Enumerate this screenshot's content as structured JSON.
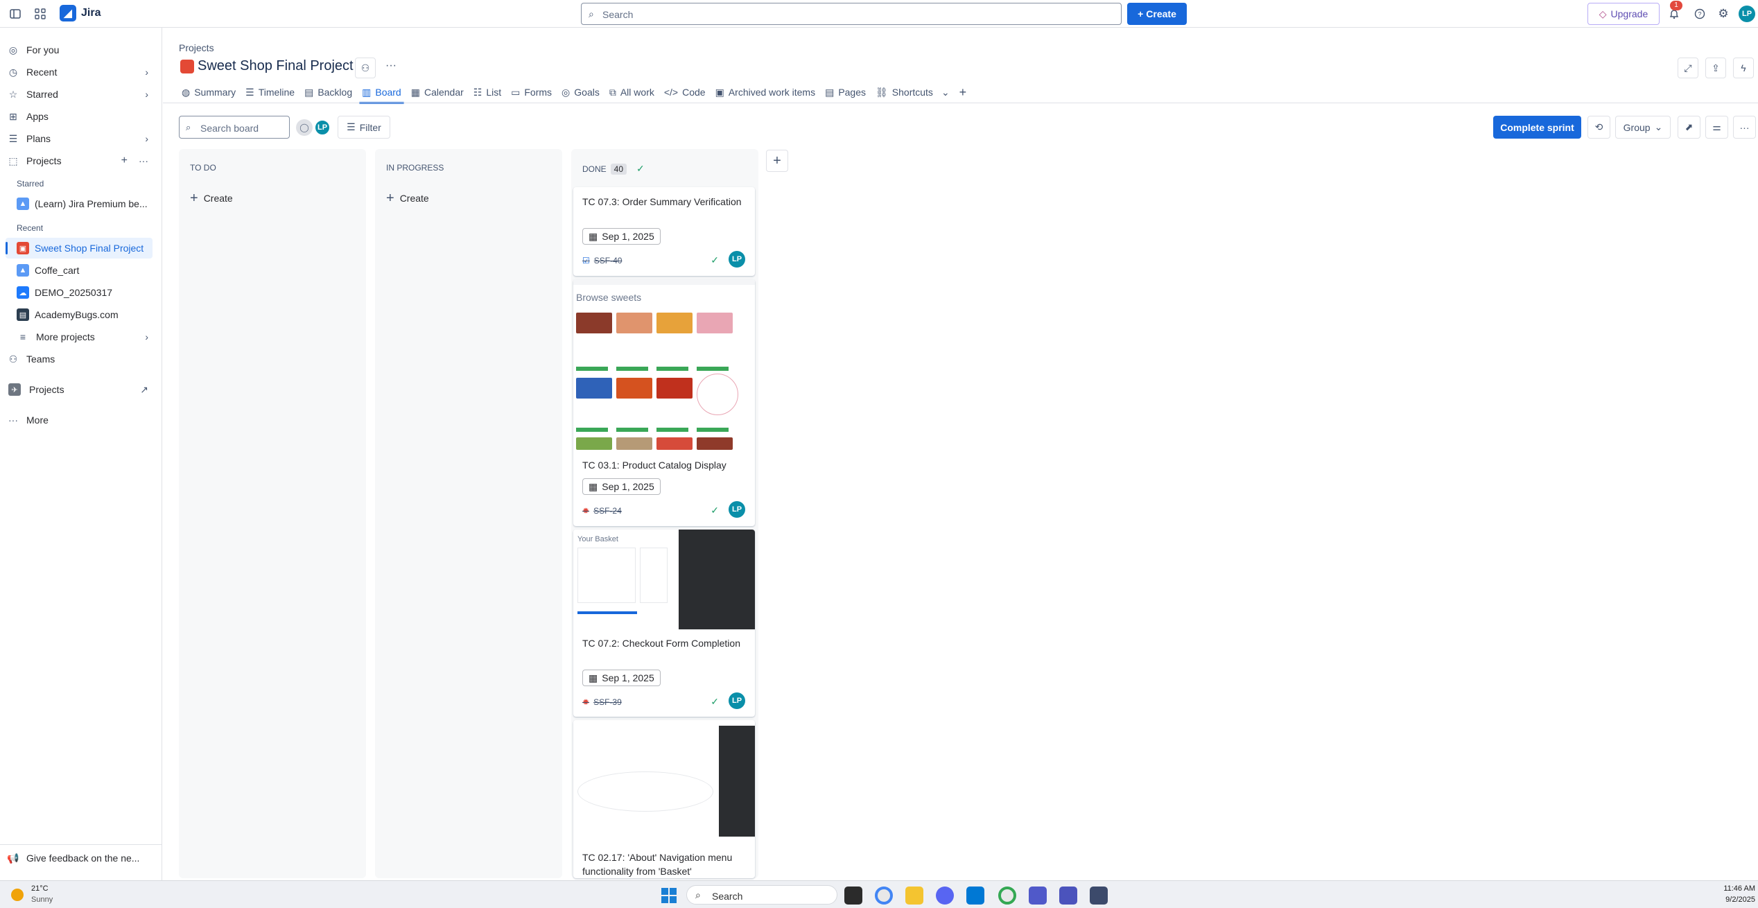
{
  "topbar": {
    "app_name": "Jira",
    "search_placeholder": "Search",
    "create_label": "Create",
    "upgrade_label": "Upgrade",
    "notification_count": "1",
    "avatar_initials": "LP"
  },
  "sidebar": {
    "items": [
      {
        "label": "For you"
      },
      {
        "label": "Recent"
      },
      {
        "label": "Starred"
      },
      {
        "label": "Apps"
      },
      {
        "label": "Plans"
      },
      {
        "label": "Projects"
      }
    ],
    "starred_heading": "Starred",
    "starred_projects": [
      {
        "label": "(Learn) Jira Premium be..."
      }
    ],
    "recent_heading": "Recent",
    "recent_projects": [
      {
        "label": "Sweet Shop Final Project"
      },
      {
        "label": "Coffe_cart"
      },
      {
        "label": "DEMO_20250317"
      },
      {
        "label": "AcademyBugs.com"
      }
    ],
    "more_projects": "More projects",
    "teams": "Teams",
    "projects_link": "Projects",
    "more": "More",
    "feedback": "Give feedback on the ne..."
  },
  "header": {
    "breadcrumb": "Projects",
    "title": "Sweet Shop Final Project",
    "tabs": [
      {
        "label": "Summary"
      },
      {
        "label": "Timeline"
      },
      {
        "label": "Backlog"
      },
      {
        "label": "Board"
      },
      {
        "label": "Calendar"
      },
      {
        "label": "List"
      },
      {
        "label": "Forms"
      },
      {
        "label": "Goals"
      },
      {
        "label": "All work"
      },
      {
        "label": "Code"
      },
      {
        "label": "Archived work items"
      },
      {
        "label": "Pages"
      },
      {
        "label": "Shortcuts"
      }
    ]
  },
  "toolbar": {
    "search_placeholder": "Search board",
    "filter_label": "Filter",
    "complete_sprint_label": "Complete sprint",
    "group_label": "Group"
  },
  "board": {
    "columns": [
      {
        "title": "TO DO",
        "create_label": "Create"
      },
      {
        "title": "IN PROGRESS",
        "create_label": "Create"
      },
      {
        "title": "DONE",
        "count": "40"
      }
    ],
    "cards": [
      {
        "title": "TC 07.3: Order Summary Verification",
        "date": "Sep 1, 2025",
        "key": "SSF-40",
        "type": "task"
      },
      {
        "title": "TC 03.1: Product Catalog Display",
        "date": "Sep 1, 2025",
        "key": "SSF-24",
        "type": "bug",
        "thumb_heading": "Browse sweets"
      },
      {
        "title": "TC 07.2: Checkout Form Completion",
        "date": "Sep 1, 2025",
        "key": "SSF-39",
        "type": "bug",
        "thumb_heading": "Your Basket"
      },
      {
        "title": "TC 02.17: 'About' Navigation menu functionality from 'Basket'",
        "type": "bug"
      }
    ]
  },
  "taskbar": {
    "weather_temp": "21°C",
    "weather_desc": "Sunny",
    "search_placeholder": "Search",
    "time": "11:46 AM",
    "date": "9/2/2025"
  }
}
